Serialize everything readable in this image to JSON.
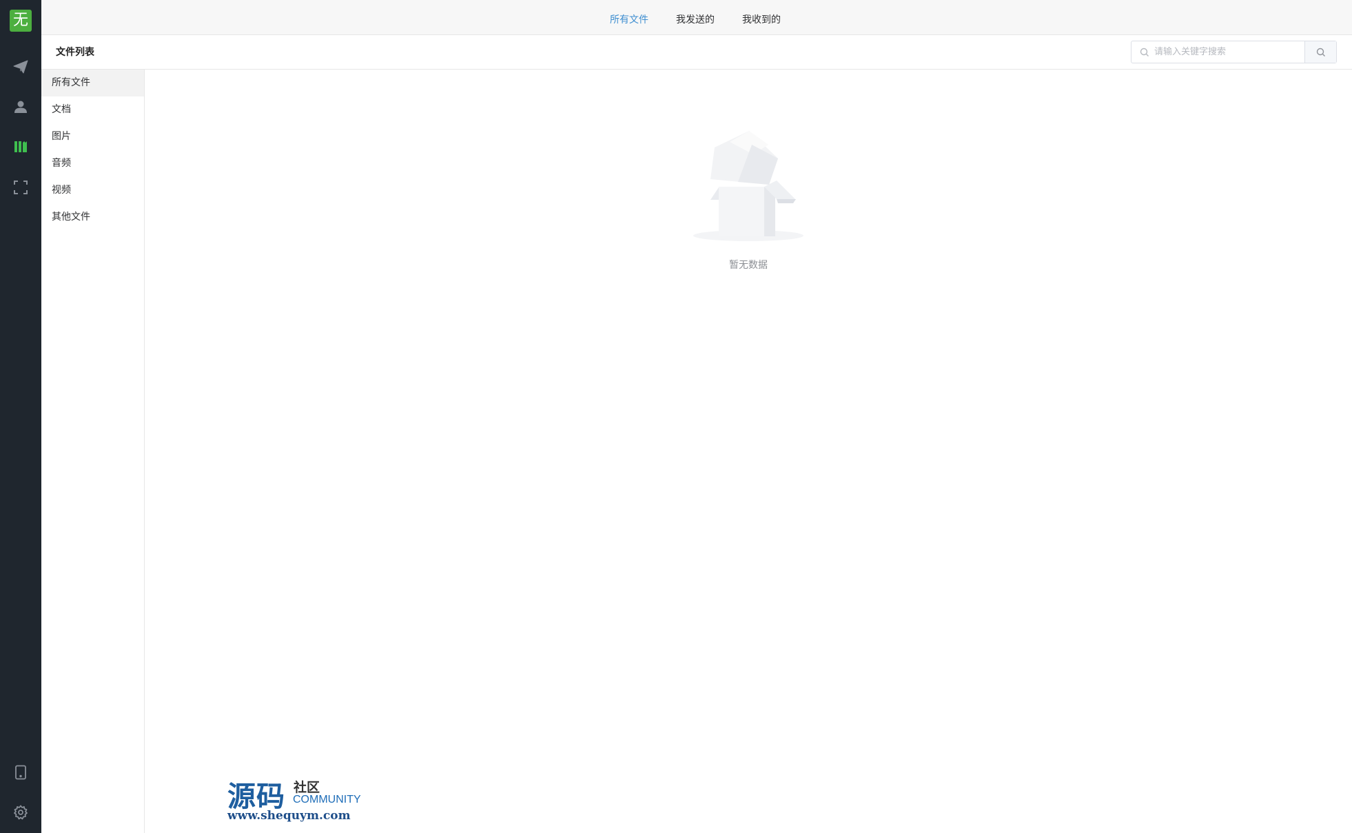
{
  "app": {
    "logo_text": "无",
    "accent_color": "#4caf3f",
    "rail_color": "#1f262e"
  },
  "rail": {
    "items": [
      {
        "icon": "send-icon"
      },
      {
        "icon": "user-icon"
      },
      {
        "icon": "files-icon",
        "active": true
      },
      {
        "icon": "scan-icon"
      },
      {
        "icon": "phone-icon"
      },
      {
        "icon": "gear-icon"
      }
    ]
  },
  "tabs": [
    {
      "label": "所有文件",
      "active": true
    },
    {
      "label": "我发送的"
    },
    {
      "label": "我收到的"
    }
  ],
  "header": {
    "title": "文件列表",
    "search_placeholder": "请输入关键字搜索"
  },
  "categories": [
    {
      "label": "所有文件",
      "active": true
    },
    {
      "label": "文档"
    },
    {
      "label": "图片"
    },
    {
      "label": "音频"
    },
    {
      "label": "视频"
    },
    {
      "label": "其他文件"
    }
  ],
  "empty_state": {
    "text": "暂无数据"
  },
  "watermark": {
    "big": "源码",
    "small": "社区",
    "community": "COMMUNITY",
    "url": "www.shequym.com"
  }
}
